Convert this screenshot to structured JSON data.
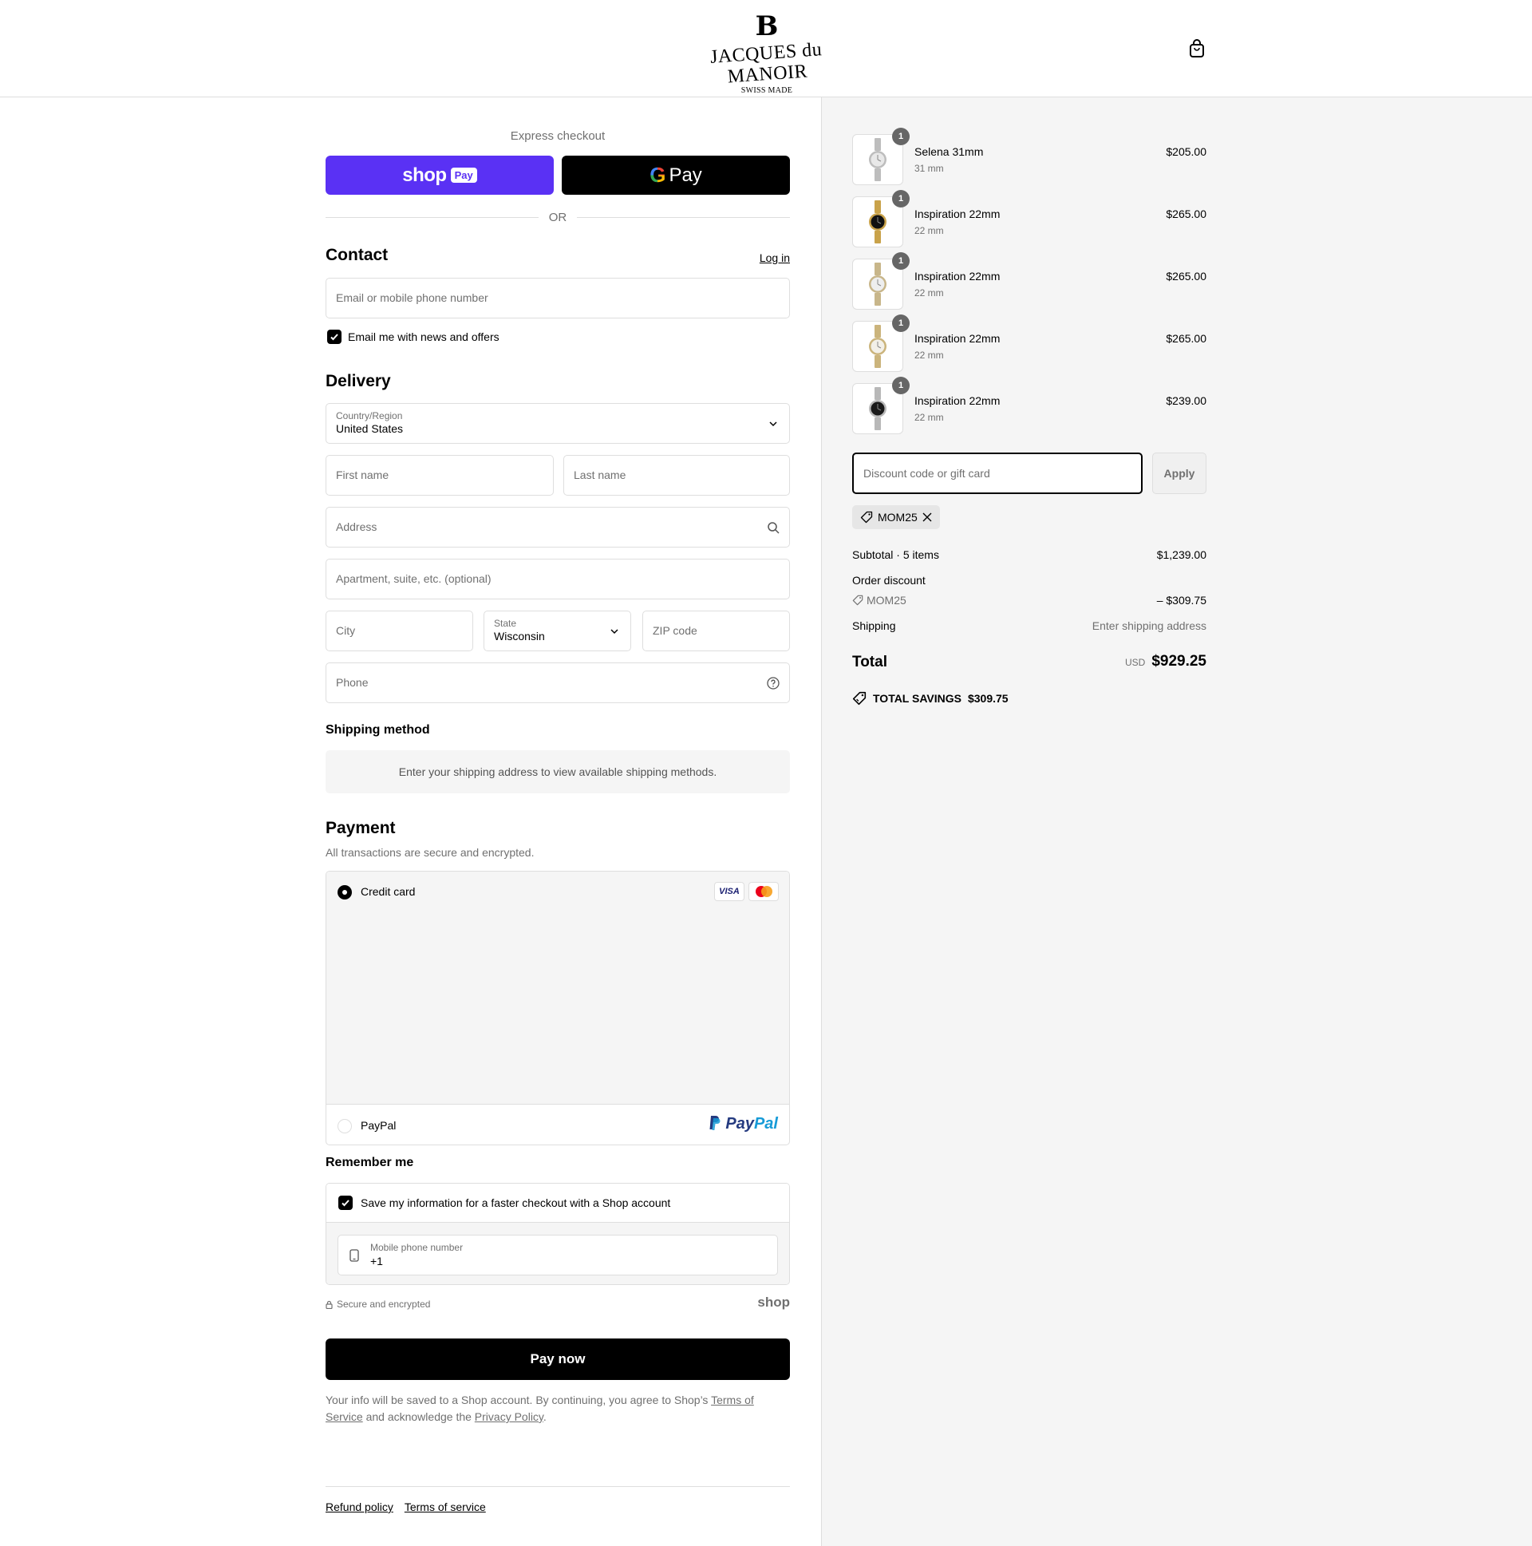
{
  "brand": {
    "mark": "B",
    "name": "JACQUES du MANOIR",
    "subtitle": "SWISS MADE"
  },
  "header": {
    "cart_icon": "shopping-bag-icon"
  },
  "express": {
    "label": "Express checkout",
    "shop_pay_word": "shop",
    "shop_pay_pill": "Pay",
    "gpay_g": "G",
    "gpay_text": "Pay",
    "or": "OR"
  },
  "contact": {
    "title": "Contact",
    "login": "Log in",
    "email_placeholder": "Email or mobile phone number",
    "news_label": "Email me with news and offers",
    "news_checked": true
  },
  "delivery": {
    "title": "Delivery",
    "country_label": "Country/Region",
    "country_value": "United States",
    "first_name_placeholder": "First name",
    "last_name_placeholder": "Last name",
    "address_placeholder": "Address",
    "apartment_placeholder": "Apartment, suite, etc. (optional)",
    "city_placeholder": "City",
    "state_label": "State",
    "state_value": "Wisconsin",
    "zip_placeholder": "ZIP code",
    "phone_placeholder": "Phone"
  },
  "shipping_method": {
    "title": "Shipping method",
    "info": "Enter your shipping address to view available shipping methods."
  },
  "payment": {
    "title": "Payment",
    "subtitle": "All transactions are secure and encrypted.",
    "credit_card_label": "Credit card",
    "visa": "VISA",
    "paypal_label": "PayPal",
    "paypal_logo_a": "Pay",
    "paypal_logo_b": "Pal"
  },
  "remember": {
    "title": "Remember me",
    "save_label": "Save my information for a faster checkout with a Shop account",
    "phone_label": "Mobile phone number",
    "phone_value": "+1",
    "secure": "Secure and encrypted",
    "shop_mark": "shop"
  },
  "pay_now": "Pay now",
  "legal": {
    "text1": "Your info will be saved to a Shop account. By continuing, you agree to Shop’s ",
    "terms": "Terms of Service",
    "text2": " and acknowledge the ",
    "privacy": "Privacy Policy",
    "text3": "."
  },
  "footer": {
    "refund": "Refund policy",
    "terms": "Terms of service"
  },
  "items": [
    {
      "name": "Selena 31mm",
      "variant": "31 mm",
      "price": "$205.00",
      "qty": "1",
      "dial": "#e8e8e8",
      "strap": "#bdbdbd"
    },
    {
      "name": "Inspiration 22mm",
      "variant": "22 mm",
      "price": "$265.00",
      "qty": "1",
      "dial": "#111111",
      "strap": "#c9a24a"
    },
    {
      "name": "Inspiration 22mm",
      "variant": "22 mm",
      "price": "$265.00",
      "qty": "1",
      "dial": "#eeeeee",
      "strap": "#c8b68a"
    },
    {
      "name": "Inspiration 22mm",
      "variant": "22 mm",
      "price": "$265.00",
      "qty": "1",
      "dial": "#f3f0e8",
      "strap": "#cbb47c"
    },
    {
      "name": "Inspiration 22mm",
      "variant": "22 mm",
      "price": "$239.00",
      "qty": "1",
      "dial": "#1a1a1a",
      "strap": "#b8b8b8"
    }
  ],
  "summary": {
    "discount_placeholder": "Discount code or gift card",
    "apply": "Apply",
    "code": "MOM25",
    "subtotal_label": "Subtotal · 5 items",
    "subtotal_value": "$1,239.00",
    "order_discount_label": "Order discount",
    "discount_code": "MOM25",
    "discount_value": "– $309.75",
    "shipping_label": "Shipping",
    "shipping_value": "Enter shipping address",
    "total_label": "Total",
    "currency": "USD",
    "total_value": "$929.25",
    "savings_label": "TOTAL SAVINGS",
    "savings_value": "$309.75"
  }
}
